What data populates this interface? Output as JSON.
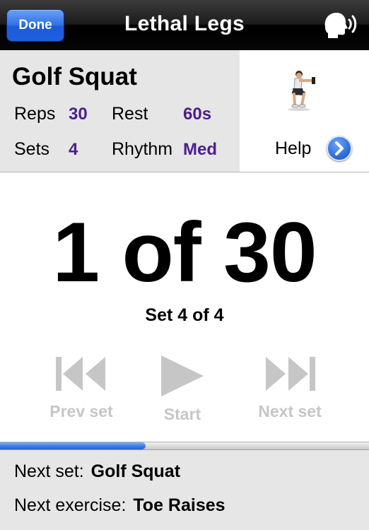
{
  "navbar": {
    "done_label": "Done",
    "title": "Lethal Legs",
    "speak_icon": "speaking-head-icon"
  },
  "exercise": {
    "name": "Golf Squat",
    "reps_label": "Reps",
    "reps_value": "30",
    "rest_label": "Rest",
    "rest_value": "60s",
    "sets_label": "Sets",
    "sets_value": "4",
    "rhythm_label": "Rhythm",
    "rhythm_value": "Med",
    "help_label": "Help",
    "value_color": "#4b1f8c"
  },
  "counter": {
    "text": "1 of 30",
    "set_text": "Set 4 of 4"
  },
  "controls": {
    "prev_label": "Prev set",
    "start_label": "Start",
    "next_label": "Next set",
    "disabled_color": "#c6c6c6"
  },
  "progress": {
    "fraction": 0.395
  },
  "footer": {
    "next_set_label": "Next set:",
    "next_set_value": "Golf Squat",
    "next_exercise_label": "Next exercise:",
    "next_exercise_value": "Toe Raises"
  }
}
